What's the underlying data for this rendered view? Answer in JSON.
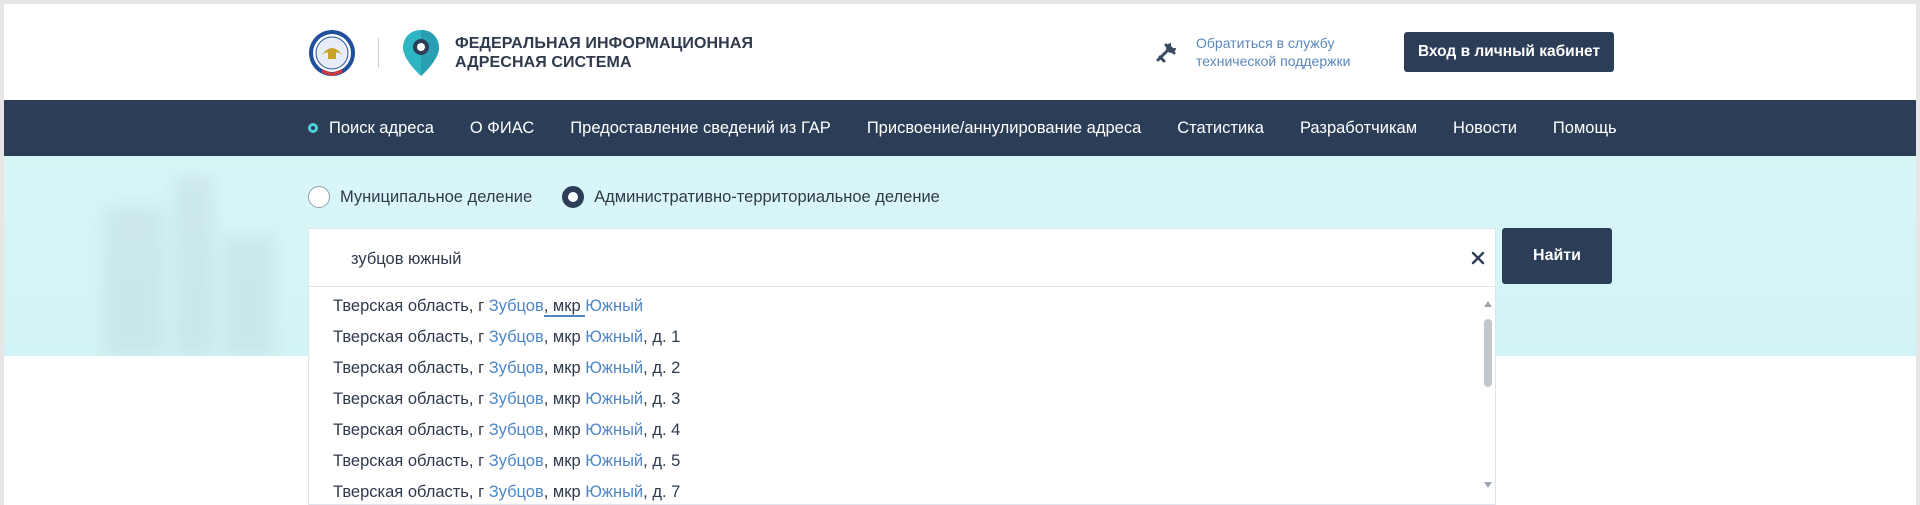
{
  "header": {
    "brand_line1": "ФЕДЕРАЛЬНАЯ ИНФОРМАЦИОННАЯ",
    "brand_line2": "АДРЕСНАЯ СИСТЕМА",
    "support_line1": "Обратиться в службу",
    "support_line2": "технической поддержки",
    "login_label": "Вход в личный кабинет"
  },
  "nav": {
    "items": [
      {
        "label": "Поиск адреса",
        "active": true
      },
      {
        "label": "О ФИАС"
      },
      {
        "label": "Предоставление сведений из ГАР"
      },
      {
        "label": "Присвоение/аннулирование адреса"
      },
      {
        "label": "Статистика"
      },
      {
        "label": "Разработчикам"
      },
      {
        "label": "Новости"
      },
      {
        "label": "Помощь"
      }
    ]
  },
  "search": {
    "division_options": [
      {
        "label": "Муниципальное деление",
        "selected": false
      },
      {
        "label": "Административно-территориальное деление",
        "selected": true
      }
    ],
    "query": "зубцов южный",
    "find_label": "Найти"
  },
  "suggestions": [
    {
      "prefix": "Тверская область, г ",
      "city": "Зубцов",
      "mid": ", мкр ",
      "district": "Южный",
      "suffix": ""
    },
    {
      "prefix": "Тверская область, г ",
      "city": "Зубцов",
      "mid": ", мкр ",
      "district": "Южный",
      "suffix": ", д. 1"
    },
    {
      "prefix": "Тверская область, г ",
      "city": "Зубцов",
      "mid": ", мкр ",
      "district": "Южный",
      "suffix": ", д. 2"
    },
    {
      "prefix": "Тверская область, г ",
      "city": "Зубцов",
      "mid": ", мкр ",
      "district": "Южный",
      "suffix": ", д. 3"
    },
    {
      "prefix": "Тверская область, г ",
      "city": "Зубцов",
      "mid": ", мкр ",
      "district": "Южный",
      "suffix": ", д. 4"
    },
    {
      "prefix": "Тверская область, г ",
      "city": "Зубцов",
      "mid": ", мкр ",
      "district": "Южный",
      "suffix": ", д. 5"
    },
    {
      "prefix": "Тверская область, г ",
      "city": "Зубцов",
      "mid": ", мкр ",
      "district": "Южный",
      "suffix": ", д. 7"
    }
  ],
  "colors": {
    "primary": "#2c3e57",
    "accent": "#4fd0d8",
    "link": "#4f86c6",
    "hero_bg": "#d9f6f7"
  },
  "icons": {
    "emblem": "fns-emblem-icon",
    "pin": "map-pin-icon",
    "support": "tools-icon",
    "clear": "close-icon"
  }
}
